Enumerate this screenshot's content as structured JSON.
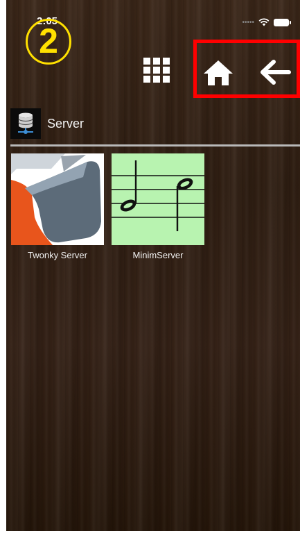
{
  "status_bar": {
    "time": "2:05",
    "icons": [
      "signal-dots-icon",
      "wifi-icon",
      "battery-icon"
    ]
  },
  "overlay": {
    "step_number": "2",
    "step_color": "#ffe000",
    "highlight_color": "#ff0000"
  },
  "toolbar": {
    "buttons": [
      "grid-view-icon",
      "home-icon",
      "back-arrow-icon"
    ]
  },
  "section": {
    "icon": "database-server-icon",
    "title": "Server"
  },
  "servers": [
    {
      "label": "Twonky Server",
      "icon": "twonky-logo"
    },
    {
      "label": "MinimServer",
      "icon": "music-notes-logo",
      "background": "#b8f3b0"
    }
  ]
}
